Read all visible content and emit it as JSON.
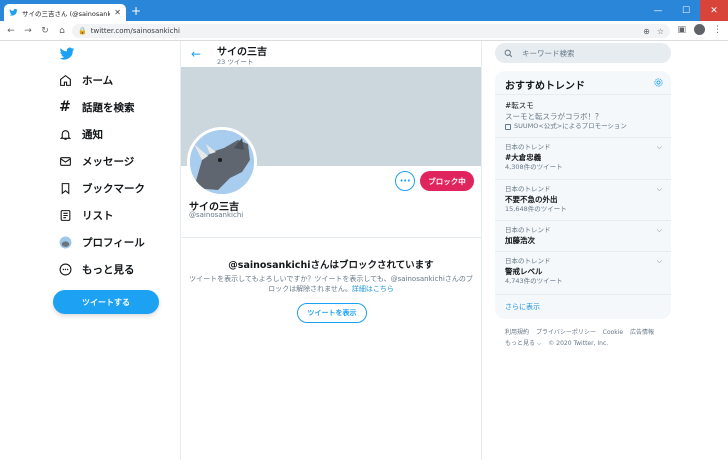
{
  "browser": {
    "tab_title": "サイの三吉さん (@sainosankichi) / ",
    "new_tab": "+",
    "url": "twitter.com/sainosankichi",
    "window_buttons": [
      "—",
      "☐",
      "✕"
    ]
  },
  "nav": {
    "items": [
      {
        "label": "ホーム",
        "icon": "home-icon"
      },
      {
        "label": "話題を検索",
        "icon": "hashtag-icon"
      },
      {
        "label": "通知",
        "icon": "bell-icon"
      },
      {
        "label": "メッセージ",
        "icon": "mail-icon"
      },
      {
        "label": "ブックマーク",
        "icon": "bookmark-icon"
      },
      {
        "label": "リスト",
        "icon": "list-icon"
      },
      {
        "label": "プロフィール",
        "icon": "avatar-icon"
      },
      {
        "label": "もっと見る",
        "icon": "more-icon"
      }
    ],
    "tweet_button": "ツイートする"
  },
  "profile": {
    "header_name": "サイの三吉",
    "tweet_count": "23 ツイート",
    "name": "サイの三吉",
    "handle": "@sainosankichi",
    "more_label": "•••",
    "block_button": "ブロック中",
    "blocked_title": "@sainosankichiさんはブロックされています",
    "blocked_desc": "ツイートを表示してもよろしいですか？ツイートを表示しても、@sainosankichiさんのブロックは解除されません。",
    "blocked_link": "詳細はこちら",
    "show_tweets": "ツイートを表示"
  },
  "search": {
    "placeholder": "キーワード検索"
  },
  "trends": {
    "heading": "おすすめトレンド",
    "items": [
      {
        "meta": "",
        "name": "#転スモ",
        "sub": "スーモと転スラがコラボ！？",
        "count": "",
        "promo": "SUUMO<公式>によるプロモーション"
      },
      {
        "meta": "日本のトレンド",
        "name": "#大倉忠義",
        "sub": "",
        "count": "4,308件のツイート",
        "promo": ""
      },
      {
        "meta": "日本のトレンド",
        "name": "不要不急の外出",
        "sub": "",
        "count": "15,648件のツイート",
        "promo": ""
      },
      {
        "meta": "日本のトレンド",
        "name": "加藤浩次",
        "sub": "",
        "count": "",
        "promo": ""
      },
      {
        "meta": "日本のトレンド",
        "name": "警戒レベル",
        "sub": "",
        "count": "4,743件のツイート",
        "promo": ""
      }
    ],
    "show_more": "さらに表示"
  },
  "footer": {
    "links": [
      "利用規約",
      "プライバシーポリシー",
      "Cookie",
      "広告情報",
      "もっと見る ⌵",
      "© 2020 Twitter, Inc."
    ]
  },
  "colors": {
    "accent": "#1da1f2",
    "block": "#e0245e",
    "banner": "#ccd6dd",
    "chrome": "#2a86d8"
  }
}
